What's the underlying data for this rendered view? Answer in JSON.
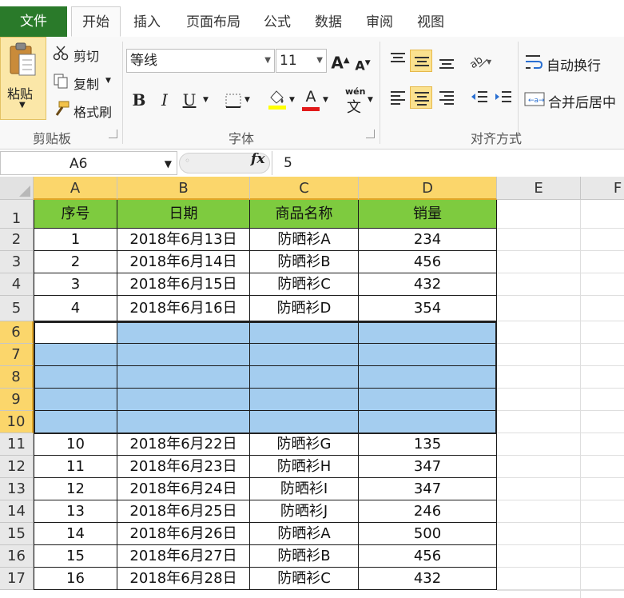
{
  "tabs": [
    "文件",
    "开始",
    "插入",
    "页面布局",
    "公式",
    "数据",
    "审阅",
    "视图"
  ],
  "clipboard": {
    "paste": "粘贴",
    "cut": "剪切",
    "copy": "复制",
    "format_painter": "格式刷",
    "label": "剪贴板"
  },
  "font": {
    "name": "等线",
    "size": "11",
    "label": "字体",
    "bold": "B",
    "italic": "I",
    "underline": "U",
    "wen": "wén",
    "wen_char": "文"
  },
  "alignment": {
    "wrap": "自动换行",
    "merge": "合并后居中",
    "label": "对齐方式"
  },
  "formula_bar": {
    "name_box": "A6",
    "fx": "fx",
    "value": "5"
  },
  "columns": [
    "A",
    "B",
    "C",
    "D",
    "E",
    "F"
  ],
  "rows": [
    "1",
    "2",
    "3",
    "4",
    "5",
    "6",
    "7",
    "8",
    "9",
    "10",
    "11",
    "12",
    "13",
    "14",
    "15",
    "16",
    "17"
  ],
  "table": {
    "headers": [
      "序号",
      "日期",
      "商品名称",
      "销量"
    ],
    "rows": [
      [
        "1",
        "2018年6月13日",
        "防晒衫A",
        "234"
      ],
      [
        "2",
        "2018年6月14日",
        "防晒衫B",
        "456"
      ],
      [
        "3",
        "2018年6月15日",
        "防晒衫C",
        "432"
      ],
      [
        "4",
        "2018年6月16日",
        "防晒衫D",
        "354"
      ],
      [
        "",
        "",
        "",
        ""
      ],
      [
        "",
        "",
        "",
        ""
      ],
      [
        "",
        "",
        "",
        ""
      ],
      [
        "",
        "",
        "",
        ""
      ],
      [
        "",
        "",
        "",
        ""
      ],
      [
        "10",
        "2018年6月22日",
        "防晒衫G",
        "135"
      ],
      [
        "11",
        "2018年6月23日",
        "防晒衫H",
        "347"
      ],
      [
        "12",
        "2018年6月24日",
        "防晒衫I",
        "347"
      ],
      [
        "13",
        "2018年6月25日",
        "防晒衫J",
        "246"
      ],
      [
        "14",
        "2018年6月26日",
        "防晒衫A",
        "500"
      ],
      [
        "15",
        "2018年6月27日",
        "防晒衫B",
        "456"
      ],
      [
        "16",
        "2018年6月28日",
        "防晒衫C",
        "432"
      ]
    ]
  },
  "colors": {
    "header_fill": "#7ecb3f",
    "selection_fill": "#a4cdef",
    "file_tab": "#2a7a2a",
    "selected_header": "#fbd66b"
  }
}
